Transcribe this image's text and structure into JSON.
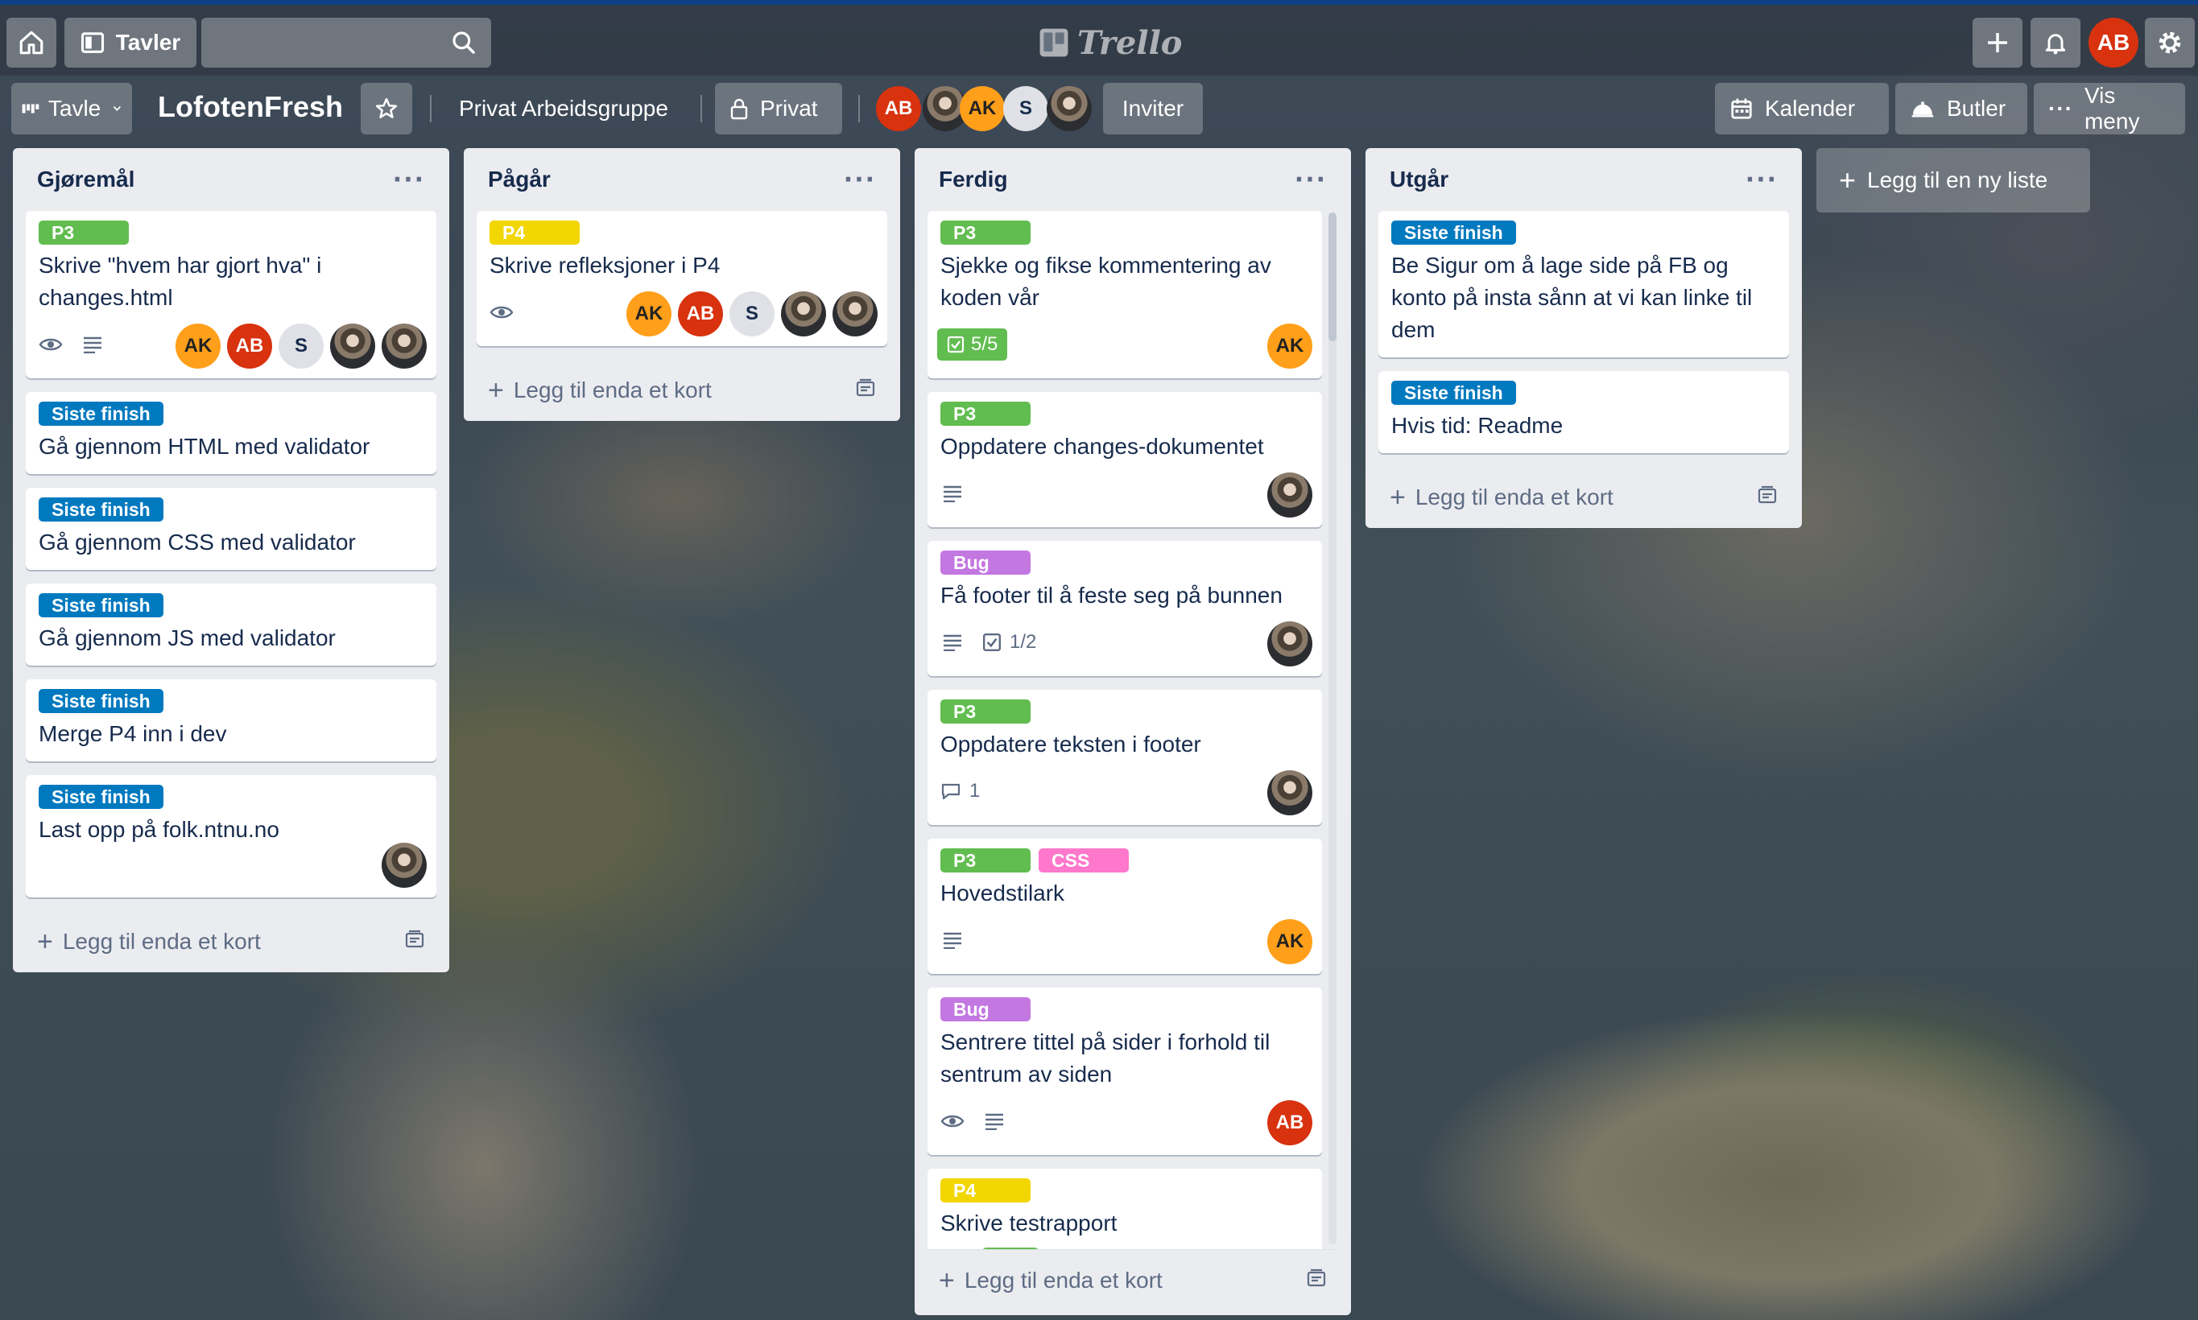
{
  "header": {
    "boards_label": "Tavler",
    "logo_text": "Trello",
    "user_initials": "AB"
  },
  "board": {
    "view_label": "Tavle",
    "title": "LofotenFresh",
    "workspace": "Privat Arbeidsgruppe",
    "visibility": "Privat",
    "invite_label": "Inviter",
    "calendar_label": "Kalender",
    "butler_label": "Butler",
    "menu_label": "Vis meny",
    "members": [
      {
        "initials": "AB",
        "color": "#d8320f"
      },
      {
        "initials": "",
        "color": "photo"
      },
      {
        "initials": "AK",
        "color": "#ff9f1a"
      },
      {
        "initials": "S",
        "color": "#dfe1e6"
      },
      {
        "initials": "",
        "color": "photo"
      }
    ]
  },
  "add_list_label": "Legg til en ny liste",
  "add_card_label": "Legg til enda et kort",
  "lists": [
    {
      "title": "Gjøremål",
      "cards": [
        {
          "labels": [
            {
              "text": "P3",
              "color": "green"
            }
          ],
          "title": "Skrive \"hvem har gjort hva\" i changes.html",
          "watch": true,
          "desc": true,
          "members": [
            "AK",
            "AB",
            "S",
            "photo",
            "photo"
          ]
        },
        {
          "labels": [
            {
              "text": "Siste finish",
              "color": "blue"
            }
          ],
          "title": "Gå gjennom HTML med validator"
        },
        {
          "labels": [
            {
              "text": "Siste finish",
              "color": "blue"
            }
          ],
          "title": "Gå gjennom CSS med validator"
        },
        {
          "labels": [
            {
              "text": "Siste finish",
              "color": "blue"
            }
          ],
          "title": "Gå gjennom JS med validator"
        },
        {
          "labels": [
            {
              "text": "Siste finish",
              "color": "blue"
            }
          ],
          "title": "Merge P4 inn i dev"
        },
        {
          "labels": [
            {
              "text": "Siste finish",
              "color": "blue"
            }
          ],
          "title": "Last opp på folk.ntnu.no",
          "members": [
            "photo"
          ]
        }
      ]
    },
    {
      "title": "Pågår",
      "cards": [
        {
          "labels": [
            {
              "text": "P4",
              "color": "yellow"
            }
          ],
          "title": "Skrive refleksjoner i P4",
          "watch": true,
          "members": [
            "AK",
            "AB",
            "S",
            "photo",
            "photo"
          ]
        }
      ]
    },
    {
      "title": "Ferdig",
      "cards": [
        {
          "labels": [
            {
              "text": "P3",
              "color": "green"
            }
          ],
          "title": "Sjekke og fikse kommentering av koden vår",
          "checklist_done": "5/5",
          "members": [
            "AK"
          ]
        },
        {
          "labels": [
            {
              "text": "P3",
              "color": "green"
            }
          ],
          "title": "Oppdatere changes-dokumentet",
          "desc": true,
          "members": [
            "photo"
          ]
        },
        {
          "labels": [
            {
              "text": "Bug",
              "color": "purple"
            }
          ],
          "title": "Få footer til å feste seg på bunnen",
          "desc": true,
          "checklist": "1/2",
          "members": [
            "photo"
          ]
        },
        {
          "labels": [
            {
              "text": "P3",
              "color": "green"
            }
          ],
          "title": "Oppdatere teksten i footer",
          "comments": "1",
          "members": [
            "photo"
          ]
        },
        {
          "labels": [
            {
              "text": "P3",
              "color": "green"
            },
            {
              "text": "CSS",
              "color": "pink"
            }
          ],
          "title": "Hovedstilark",
          "desc": true,
          "members": [
            "AK"
          ]
        },
        {
          "labels": [
            {
              "text": "Bug",
              "color": "purple"
            }
          ],
          "title": "Sentrere tittel på sider i forhold til sentrum av siden",
          "watch": true,
          "desc": true,
          "members": [
            "AB"
          ]
        },
        {
          "labels": [
            {
              "text": "P4",
              "color": "yellow"
            }
          ],
          "title": "Skrive testrapport"
        }
      ]
    },
    {
      "title": "Utgår",
      "cards": [
        {
          "labels": [
            {
              "text": "Siste finish",
              "color": "blue"
            }
          ],
          "title": "Be Sigur om å lage side på FB og konto på insta sånn at vi kan linke til dem"
        },
        {
          "labels": [
            {
              "text": "Siste finish",
              "color": "blue"
            }
          ],
          "title": "Hvis tid: Readme"
        }
      ]
    }
  ]
}
